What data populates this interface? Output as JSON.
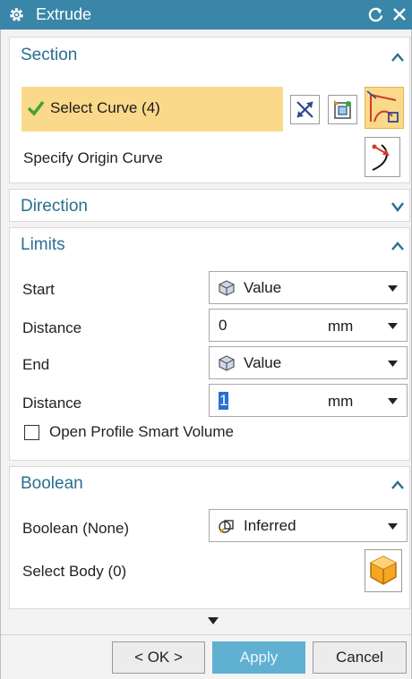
{
  "window": {
    "title": "Extrude"
  },
  "section": {
    "title": "Section",
    "select_curve_label": "Select Curve (4)",
    "specify_origin_label": "Specify Origin Curve"
  },
  "direction": {
    "title": "Direction"
  },
  "limits": {
    "title": "Limits",
    "start_label": "Start",
    "start_value": "Value",
    "start_distance_label": "Distance",
    "start_distance_value": "0",
    "start_distance_unit": "mm",
    "end_label": "End",
    "end_value": "Value",
    "end_distance_label": "Distance",
    "end_distance_value": "1",
    "end_distance_unit": "mm",
    "open_profile_label": "Open Profile Smart Volume"
  },
  "boolean": {
    "title": "Boolean",
    "boolean_label": "Boolean (None)",
    "boolean_value": "Inferred",
    "select_body_label": "Select Body (0)"
  },
  "footer": {
    "ok_label": "< OK >",
    "apply_label": "Apply",
    "cancel_label": "Cancel"
  },
  "colors": {
    "titlebar": "#3a86a8",
    "section_title": "#2a6f8f",
    "highlight": "#fbd98a",
    "apply": "#5fb0d1"
  }
}
